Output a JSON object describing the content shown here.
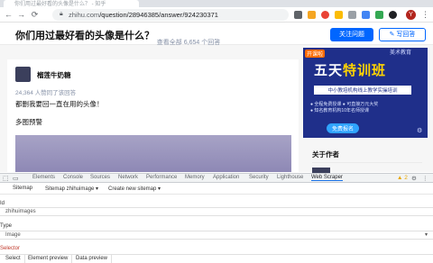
{
  "browser": {
    "tab_title": "你们用过最好看的头像是什么？ - 知乎",
    "url_host": "zhihu.com",
    "url_path": "/question/28946385/answer/924230371",
    "profile_initial": "Y"
  },
  "header": {
    "question_title": "你们用过最好看的头像是什么？",
    "follow_label": "关注问题",
    "write_label": "写回答"
  },
  "main": {
    "view_all": "查看全部 6,654 个回答",
    "author_name": "榴莲牛奶糖",
    "upvotes": "24,364 人赞同了该回答",
    "answer_lines": [
      "都删我要回一直在用的头像！",
      "多图预警"
    ]
  },
  "sidebar": {
    "ad_badge": "开课啦",
    "ad_brand": "美术教育",
    "ad_title_a": "五天",
    "ad_title_b": "特训班",
    "ad_subtitle": "中小教培机构线上教学实操培训",
    "ad_points": [
      "● 全程免费授课  ● 可直接万元大奖",
      "● 知名教育机构10年名师授课"
    ],
    "ad_cta": "免费报名",
    "about_author": "关于作者"
  },
  "devtools": {
    "tabs": [
      "Elements",
      "Console",
      "Sources",
      "Network",
      "Performance",
      "Memory",
      "Application",
      "Security",
      "Lighthouse",
      "Web Scraper"
    ],
    "active_tab": "Web Scraper",
    "warning_count": "▲ 2"
  },
  "webscraper": {
    "toolbar": [
      "Sitemap",
      "Sitemap zhihuimage ▾",
      "Create new sitemap ▾"
    ],
    "id_label": "Id",
    "id_value": "zhihuimages",
    "type_label": "Type",
    "type_value": "Image",
    "selector_label": "Selector",
    "bottom_buttons": [
      "Select",
      "Element preview",
      "Data preview"
    ]
  }
}
